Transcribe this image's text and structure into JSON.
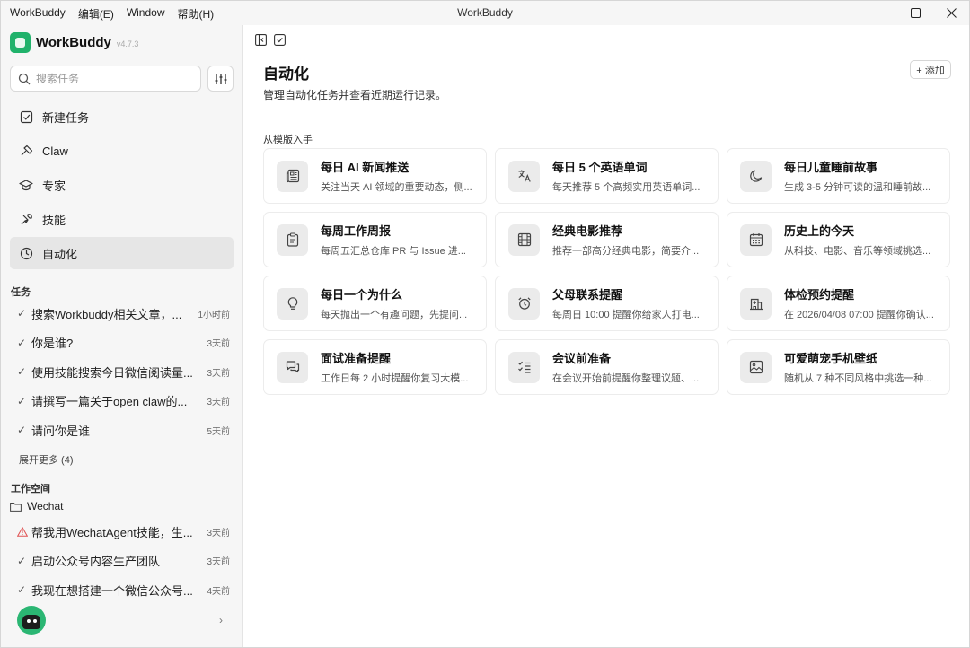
{
  "window": {
    "title": "WorkBuddy",
    "menu": [
      "WorkBuddy",
      "编辑(E)",
      "Window",
      "帮助(H)"
    ]
  },
  "brand": {
    "name": "WorkBuddy",
    "version": "v4.7.3"
  },
  "search": {
    "placeholder": "搜索任务"
  },
  "nav": [
    {
      "label": "新建任务",
      "icon": "new-task-icon"
    },
    {
      "label": "Claw",
      "icon": "claw-icon"
    },
    {
      "label": "专家",
      "icon": "expert-icon"
    },
    {
      "label": "技能",
      "icon": "skills-icon"
    },
    {
      "label": "自动化",
      "icon": "clock-icon",
      "active": true
    }
  ],
  "tasks": {
    "label": "任务",
    "items": [
      {
        "text": "搜索Workbuddy相关文章，...",
        "time": "1小时前"
      },
      {
        "text": "你是谁?",
        "time": "3天前"
      },
      {
        "text": "使用技能搜索今日微信阅读量...",
        "time": "3天前"
      },
      {
        "text": "请撰写一篇关于open claw的...",
        "time": "3天前"
      },
      {
        "text": "请问你是谁",
        "time": "5天前"
      }
    ],
    "expand_more": "展开更多 (4)"
  },
  "workspace": {
    "label": "工作空间",
    "folder": "Wechat",
    "items": [
      {
        "text": "帮我用WechatAgent技能，生...",
        "time": "3天前",
        "status": "warning"
      },
      {
        "text": "启动公众号内容生产团队",
        "time": "3天前",
        "status": "done"
      },
      {
        "text": "我现在想搭建一个微信公众号...",
        "time": "4天前",
        "status": "done"
      }
    ]
  },
  "main": {
    "title": "自动化",
    "subtitle": "管理自动化任务并查看近期运行记录。",
    "add_label": "+ 添加",
    "group_label": "从模版入手",
    "cards": [
      {
        "title": "每日 AI 新闻推送",
        "desc": "关注当天 AI 领域的重要动态，侧...",
        "icon": "newspaper-icon"
      },
      {
        "title": "每日 5 个英语单词",
        "desc": "每天推荐 5 个高频实用英语单词...",
        "icon": "translate-icon"
      },
      {
        "title": "每日儿童睡前故事",
        "desc": "生成 3-5 分钟可读的温和睡前故...",
        "icon": "moon-icon"
      },
      {
        "title": "每周工作周报",
        "desc": "每周五汇总仓库 PR 与 Issue 进...",
        "icon": "clipboard-icon"
      },
      {
        "title": "经典电影推荐",
        "desc": "推荐一部高分经典电影，简要介...",
        "icon": "film-icon"
      },
      {
        "title": "历史上的今天",
        "desc": "从科技、电影、音乐等领域挑选...",
        "icon": "calendar-icon"
      },
      {
        "title": "每日一个为什么",
        "desc": "每天抛出一个有趣问题，先提问...",
        "icon": "lightbulb-icon"
      },
      {
        "title": "父母联系提醒",
        "desc": "每周日 10:00 提醒你给家人打电...",
        "icon": "alarm-icon"
      },
      {
        "title": "体检预约提醒",
        "desc": "在 2026/04/08 07:00 提醒你确认...",
        "icon": "hospital-icon"
      },
      {
        "title": "面试准备提醒",
        "desc": "工作日每 2 小时提醒你复习大模...",
        "icon": "chat-icon"
      },
      {
        "title": "会议前准备",
        "desc": "在会议开始前提醒你整理议题、...",
        "icon": "checklist-icon"
      },
      {
        "title": "可爱萌宠手机壁纸",
        "desc": "随机从 7 种不同风格中挑选一种...",
        "icon": "image-icon"
      }
    ]
  },
  "colors": {
    "accent": "#20b26b",
    "sidebar_bg": "#f6f6f6",
    "active_bg": "#e6e6e6",
    "warning": "#e05252"
  }
}
